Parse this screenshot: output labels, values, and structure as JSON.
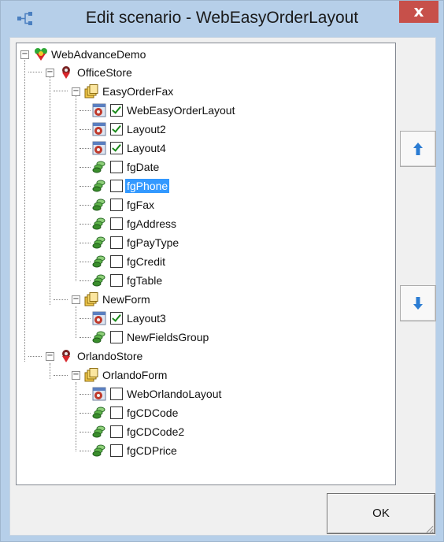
{
  "window": {
    "title": "Edit scenario - WebEasyOrderLayout",
    "close_label": "x"
  },
  "tree": {
    "root": "WebAdvanceDemo",
    "store1": "OfficeStore",
    "form1": "EasyOrderFax",
    "form1_items": [
      {
        "label": "WebEasyOrderLayout",
        "checked": true,
        "icon": "layout-icon"
      },
      {
        "label": "Layout2",
        "checked": true,
        "icon": "layout-icon"
      },
      {
        "label": "Layout4",
        "checked": true,
        "icon": "layout-icon"
      },
      {
        "label": "fgDate",
        "checked": false,
        "icon": "field-group-icon"
      },
      {
        "label": "fgPhone",
        "checked": false,
        "icon": "field-group-icon",
        "selected": true
      },
      {
        "label": "fgFax",
        "checked": false,
        "icon": "field-group-icon"
      },
      {
        "label": "fgAddress",
        "checked": false,
        "icon": "field-group-icon"
      },
      {
        "label": "fgPayType",
        "checked": false,
        "icon": "field-group-icon"
      },
      {
        "label": "fgCredit",
        "checked": false,
        "icon": "field-group-icon"
      },
      {
        "label": "fgTable",
        "checked": false,
        "icon": "field-group-icon"
      }
    ],
    "form2": "NewForm",
    "form2_items": [
      {
        "label": "Layout3",
        "checked": true,
        "icon": "layout-icon"
      },
      {
        "label": "NewFieldsGroup",
        "checked": false,
        "icon": "field-group-icon"
      }
    ],
    "store2": "OrlandoStore",
    "form3": "OrlandoForm",
    "form3_items": [
      {
        "label": "WebOrlandoLayout",
        "checked": false,
        "icon": "layout-icon"
      },
      {
        "label": "fgCDCode",
        "checked": false,
        "icon": "field-group-icon"
      },
      {
        "label": "fgCDCode2",
        "checked": false,
        "icon": "field-group-icon"
      },
      {
        "label": "fgCDPrice",
        "checked": false,
        "icon": "field-group-icon"
      }
    ]
  },
  "buttons": {
    "ok_label": "OK",
    "move_up_icon": "arrow-up-icon",
    "move_down_icon": "arrow-down-icon"
  },
  "colors": {
    "title_bar": "#b6cfe9",
    "close_button": "#c7504a",
    "selection": "#3399ff",
    "arrow_blue": "#2b7cd3"
  }
}
